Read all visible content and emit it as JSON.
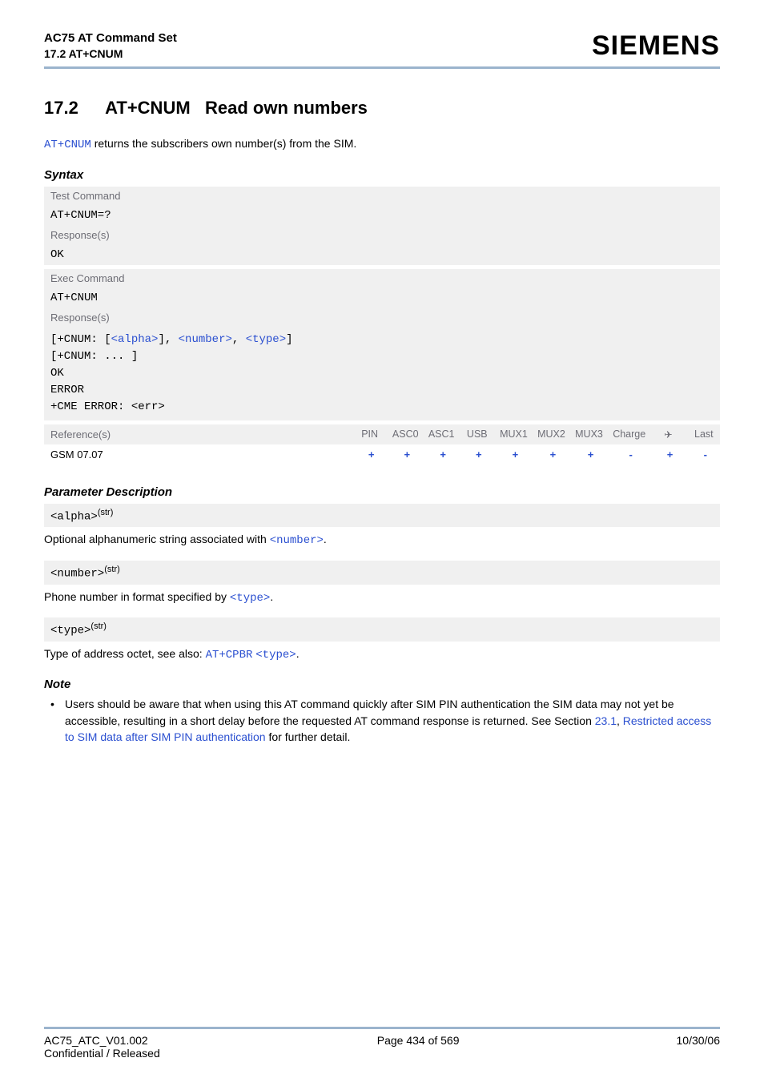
{
  "header": {
    "title": "AC75 AT Command Set",
    "subtitle": "17.2 AT+CNUM",
    "logo": "SIEMENS"
  },
  "section": {
    "number": "17.2",
    "cmd": "AT+CNUM",
    "name": "Read own numbers"
  },
  "intro": {
    "cmd": "AT+CNUM",
    "text_after": " returns the subscribers own number(s) from the SIM."
  },
  "syntax": {
    "heading": "Syntax",
    "test_label": "Test Command",
    "test_cmd": "AT+CNUM=?",
    "resp_label": "Response(s)",
    "ok": "OK",
    "exec_label": "Exec Command",
    "exec_cmd": "AT+CNUM",
    "exec_resp_lines": {
      "l1_open": "[",
      "l1_cnum": "+CNUM: ",
      "l1_alpha": "<alpha>",
      "l1_comma1": "], ",
      "l1_number": "<number>",
      "l1_comma2": ", ",
      "l1_type": "<type>",
      "l1_close": "]",
      "l2": "[+CNUM: ... ]",
      "l3": "OK",
      "l4": "ERROR",
      "l5": "+CME ERROR: <err>"
    }
  },
  "reftable": {
    "refs_label": "Reference(s)",
    "cols": [
      "PIN",
      "ASC0",
      "ASC1",
      "USB",
      "MUX1",
      "MUX2",
      "MUX3",
      "Charge",
      "✈",
      "Last"
    ],
    "row_label": "GSM 07.07",
    "row_vals": [
      "+",
      "+",
      "+",
      "+",
      "+",
      "+",
      "+",
      "-",
      "+",
      "-"
    ]
  },
  "params": {
    "heading": "Parameter Description",
    "alpha": {
      "name": "<alpha>",
      "sup": "(str)",
      "desc_pre": "Optional alphanumeric string associated with ",
      "desc_link": "<number>",
      "desc_post": "."
    },
    "number": {
      "name": "<number>",
      "sup": "(str)",
      "desc_pre": "Phone number in format specified by ",
      "desc_link": "<type>",
      "desc_post": "."
    },
    "type": {
      "name": "<type>",
      "sup": "(str)",
      "desc_pre": "Type of address octet, see also: ",
      "desc_link1": "AT+CPBR",
      "desc_space": " ",
      "desc_link2": "<type>",
      "desc_post": "."
    }
  },
  "note": {
    "heading": "Note",
    "text_pre": "Users should be aware that when using this AT command quickly after SIM PIN authentication the SIM data may not yet be accessible, resulting in a short delay before the requested AT command response is returned. See Section ",
    "link1": "23.1",
    "mid": ", ",
    "link2": "Restricted access to SIM data after SIM PIN authentication",
    "text_post": " for further detail."
  },
  "footer": {
    "left1": "AC75_ATC_V01.002",
    "left2": "Confidential / Released",
    "center": "Page 434 of 569",
    "right": "10/30/06"
  }
}
